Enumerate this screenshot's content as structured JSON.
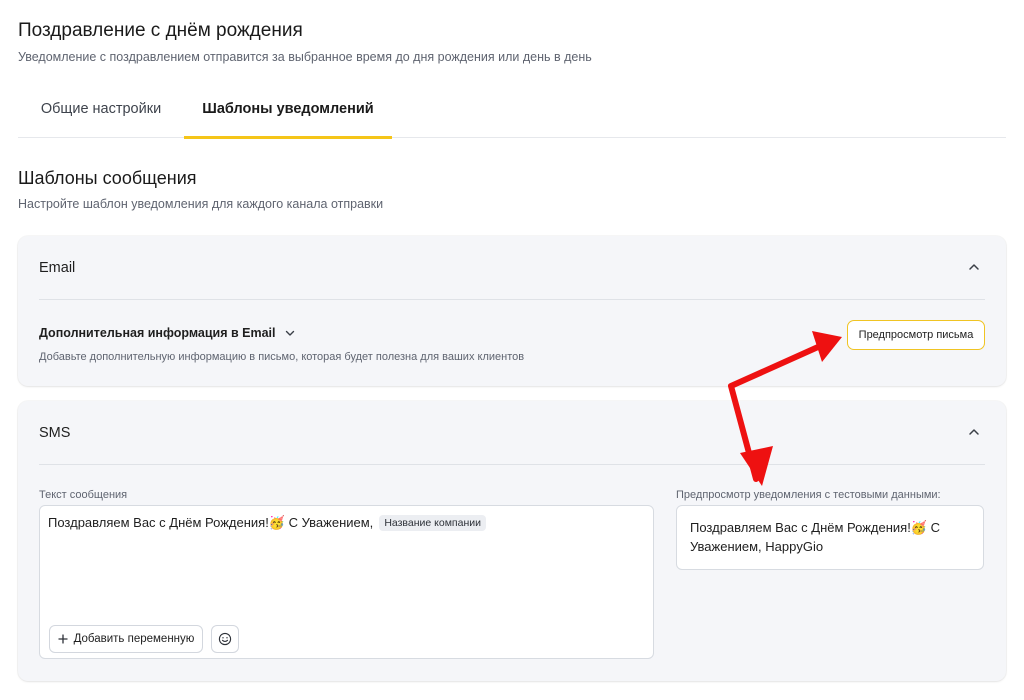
{
  "page": {
    "title": "Поздравление с днём рождения",
    "subtitle": "Уведомление с поздравлением отправится за выбранное время до дня рождения или день в день"
  },
  "tabs": [
    {
      "label": "Общие настройки",
      "active": false
    },
    {
      "label": "Шаблоны уведомлений",
      "active": true
    }
  ],
  "section": {
    "title": "Шаблоны сообщения",
    "subtitle": "Настройте шаблон уведомления для каждого канала отправки"
  },
  "email": {
    "title": "Email",
    "extra_info_title": "Дополнительная информация в Email",
    "extra_info_desc": "Добавьте дополнительную информацию в письмо, которая будет полезна для ваших клиентов",
    "preview_button": "Предпросмотр письма"
  },
  "sms": {
    "title": "SMS",
    "text_label": "Текст сообщения",
    "message_text": "Поздравляем Вас с Днём Рождения!🥳 С Уважением,",
    "variable_chip": "Название компании",
    "add_variable_button": "Добавить переменную",
    "preview_label": "Предпросмотр уведомления с тестовыми данными:",
    "preview_text": "Поздравляем Вас с Днём Рождения!🥳 С Уважением, HappyGio"
  },
  "colors": {
    "accent": "#f5c518",
    "annotation_arrow": "#ee1111",
    "card_bg": "#f5f6f9"
  },
  "icons": [
    "chevron-up-icon",
    "chevron-down-icon",
    "plus-icon",
    "smile-icon"
  ]
}
